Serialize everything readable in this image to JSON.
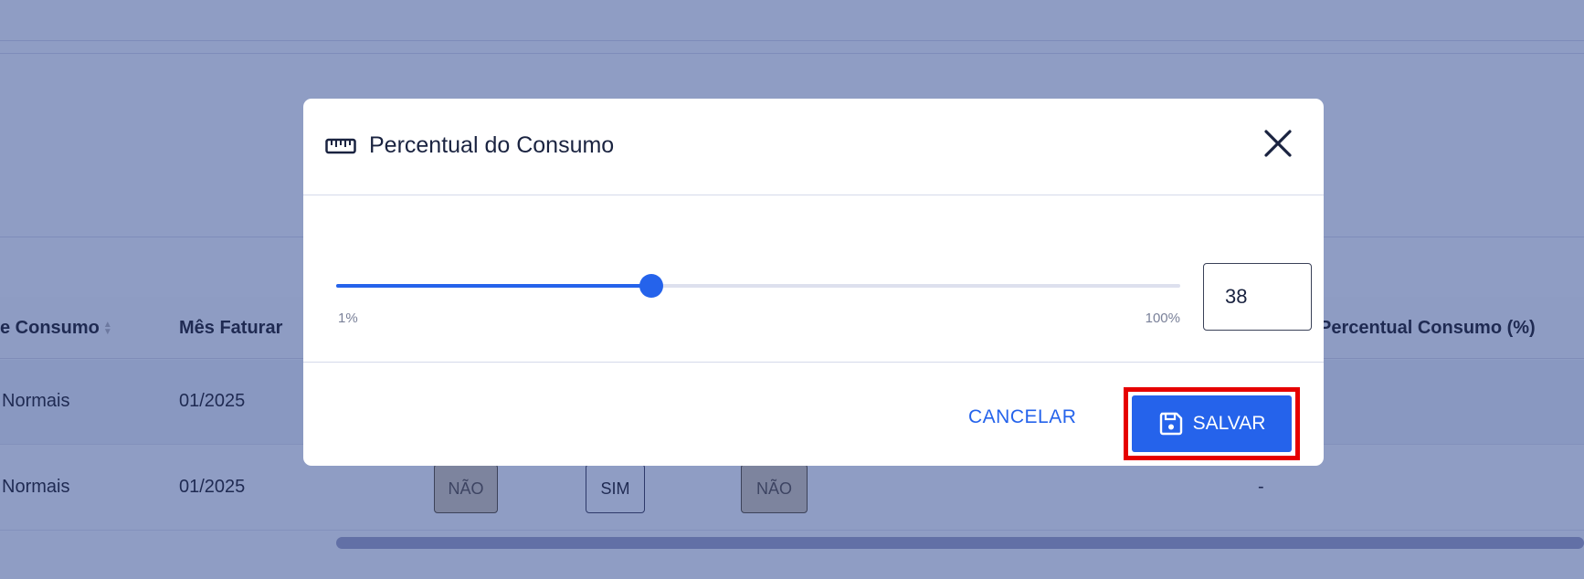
{
  "background_table": {
    "headers": {
      "consumo": "e Consumo",
      "mes": "Mês Faturar",
      "percentual": "Percentual Consumo (%)"
    },
    "rows": [
      {
        "consumo": "Normais",
        "mes": "01/2025"
      },
      {
        "consumo": "Normais",
        "mes": "01/2025",
        "chip1": "NÃO",
        "chip2": "SIM",
        "chip3": "NÃO",
        "percentual": "-"
      }
    ]
  },
  "modal": {
    "title": "Percentual do Consumo",
    "title_icon": "ruler-icon",
    "close_icon": "close-icon",
    "slider": {
      "min_label": "1%",
      "max_label": "100%",
      "min": 1,
      "max": 100,
      "value": 38
    },
    "input_value": "38",
    "cancel_label": "CANCELAR",
    "save_label": "SALVAR",
    "save_icon": "save-icon"
  },
  "colors": {
    "primary": "#2563eb",
    "overlay": "#8f9dc4",
    "highlight": "#e60000"
  }
}
